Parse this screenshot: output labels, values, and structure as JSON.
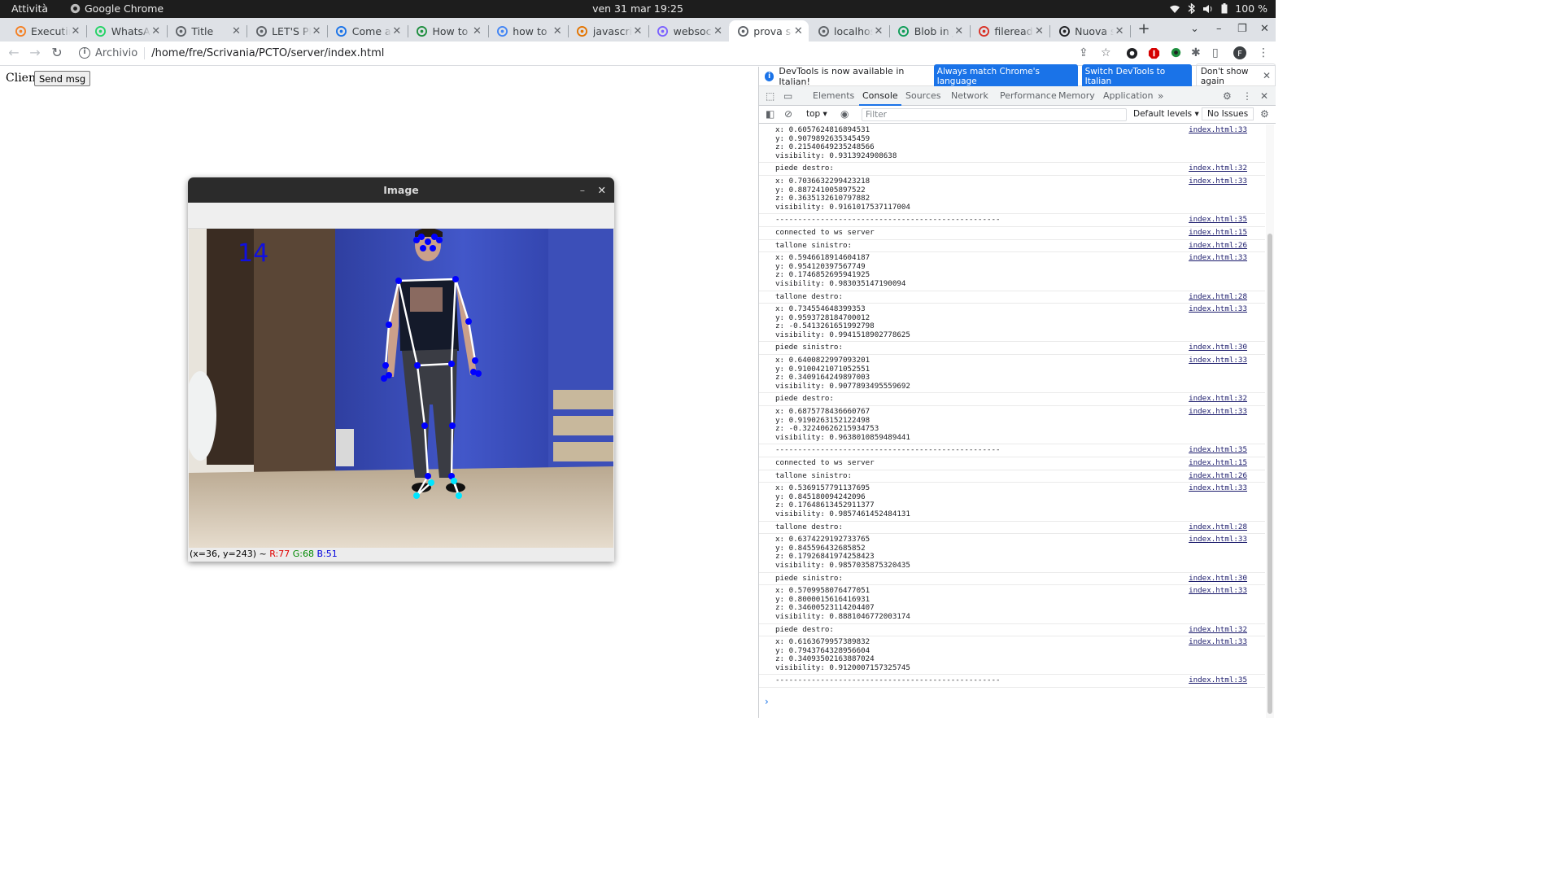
{
  "topbar": {
    "activities": "Attività",
    "app": "Google Chrome",
    "clock": "ven 31 mar  19:25",
    "battery": "100 %"
  },
  "tabs": [
    {
      "title": "Executin",
      "icon": "stackoverflow-icon"
    },
    {
      "title": "WhatsA",
      "icon": "whatsapp-icon"
    },
    {
      "title": "Title",
      "icon": "globe-icon"
    },
    {
      "title": "LET'S PL",
      "icon": "globe-icon"
    },
    {
      "title": "Come ac",
      "icon": "bird-icon"
    },
    {
      "title": "How to",
      "icon": "link-icon"
    },
    {
      "title": "how to f",
      "icon": "google-icon"
    },
    {
      "title": "javascrip",
      "icon": "orange-icon"
    },
    {
      "title": "websock",
      "icon": "hexagon-icon"
    },
    {
      "title": "prova sc",
      "icon": "globe-icon",
      "active": true
    },
    {
      "title": "localhos",
      "icon": "globe-icon"
    },
    {
      "title": "Blob in J",
      "icon": "green-icon"
    },
    {
      "title": "fileread",
      "icon": "red-icon"
    },
    {
      "title": "Nuova s",
      "icon": "github-icon"
    }
  ],
  "omnibox": {
    "scheme": "Archivio",
    "url": "/home/fre/Scrivania/PCTO/server/index.html"
  },
  "page": {
    "label": "Client",
    "button": "Send msg"
  },
  "cv_window": {
    "title": "Image",
    "overlay_number": "14",
    "status_coords": "(x=36, y=243) ~",
    "status_r": "R:77",
    "status_g": "G:68",
    "status_b": "B:51"
  },
  "devtools": {
    "infobar_text": "DevTools is now available in Italian!",
    "btn_match": "Always match Chrome's language",
    "btn_switch": "Switch DevTools to Italian",
    "btn_dont": "Don't show again",
    "tabs": [
      "Elements",
      "Console",
      "Sources",
      "Network",
      "Performance",
      "Memory",
      "Application"
    ],
    "context": "top",
    "filter_placeholder": "Filter",
    "levels": "Default levels",
    "issues": "No Issues"
  },
  "console_messages": [
    {
      "lines": [
        "x: 0.6057624816894531",
        "y: 0.9079892635345459",
        "z: 0.21540649235248566",
        "visibility: 0.9313924908638"
      ],
      "src": "index.html:33"
    },
    {
      "lines": [
        "piede destro:"
      ],
      "src": "index.html:32"
    },
    {
      "lines": [
        "x: 0.7036632299423218",
        "y: 0.887241005897522",
        "z: 0.3635132610797882",
        "visibility: 0.9161017537117004"
      ],
      "src": "index.html:33"
    },
    {
      "lines": [
        "--------------------------------------------------"
      ],
      "src": "index.html:35"
    },
    {
      "lines": [
        "connected to ws server"
      ],
      "src": "index.html:15"
    },
    {
      "lines": [
        "tallone sinistro:"
      ],
      "src": "index.html:26"
    },
    {
      "lines": [
        "x: 0.5946618914604187",
        "y: 0.954120397567749",
        "z: 0.1746852695941925",
        "visibility: 0.983035147190094"
      ],
      "src": "index.html:33"
    },
    {
      "lines": [
        "tallone destro:"
      ],
      "src": "index.html:28"
    },
    {
      "lines": [
        "x: 0.734554648399353",
        "y: 0.9593728184700012",
        "z: -0.5413261651992798",
        "visibility: 0.9941518902778625"
      ],
      "src": "index.html:33"
    },
    {
      "lines": [
        "piede sinistro:"
      ],
      "src": "index.html:30"
    },
    {
      "lines": [
        "x: 0.6400822997093201",
        "y: 0.9100421071052551",
        "z: 0.3409164249897003",
        "visibility: 0.9077893495559692"
      ],
      "src": "index.html:33"
    },
    {
      "lines": [
        "piede destro:"
      ],
      "src": "index.html:32"
    },
    {
      "lines": [
        "x: 0.6875778436660767",
        "y: 0.9190263152122498",
        "z: -0.32240626215934753",
        "visibility: 0.9638010859489441"
      ],
      "src": "index.html:33"
    },
    {
      "lines": [
        "--------------------------------------------------"
      ],
      "src": "index.html:35"
    },
    {
      "lines": [
        "connected to ws server"
      ],
      "src": "index.html:15"
    },
    {
      "lines": [
        "tallone sinistro:"
      ],
      "src": "index.html:26"
    },
    {
      "lines": [
        "x: 0.5369157791137695",
        "y: 0.845180094242096",
        "z: 0.17648613452911377",
        "visibility: 0.9857461452484131"
      ],
      "src": "index.html:33"
    },
    {
      "lines": [
        "tallone destro:"
      ],
      "src": "index.html:28"
    },
    {
      "lines": [
        "x: 0.6374229192733765",
        "y: 0.845596432685852",
        "z: 0.17926841974258423",
        "visibility: 0.9857035875320435"
      ],
      "src": "index.html:33"
    },
    {
      "lines": [
        "piede sinistro:"
      ],
      "src": "index.html:30"
    },
    {
      "lines": [
        "x: 0.5709958076477051",
        "y: 0.8000015616416931",
        "z: 0.34600523114204407",
        "visibility: 0.8881046772003174"
      ],
      "src": "index.html:33"
    },
    {
      "lines": [
        "piede destro:"
      ],
      "src": "index.html:32"
    },
    {
      "lines": [
        "x: 0.6163679957389832",
        "y: 0.7943764328956604",
        "z: 0.34093502163887024",
        "visibility: 0.9120007157325745"
      ],
      "src": "index.html:33"
    },
    {
      "lines": [
        "--------------------------------------------------"
      ],
      "src": "index.html:35"
    }
  ],
  "colors": {
    "landmark": "#0000ff",
    "heel": "#00e5ff",
    "skeleton": "#ffffff",
    "accent": "#1a73e8"
  }
}
